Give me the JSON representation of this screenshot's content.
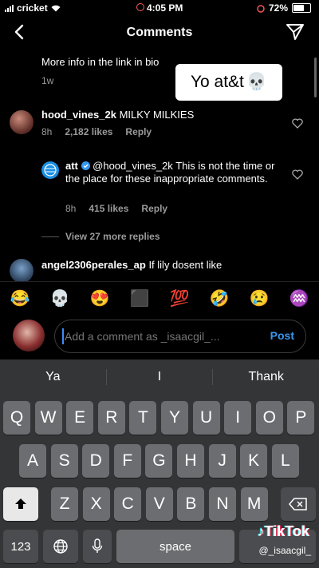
{
  "status": {
    "carrier": "cricket",
    "time": "4:05 PM",
    "battery": "72%",
    "battery_level": 0.72
  },
  "header": {
    "title": "Comments"
  },
  "caption": {
    "text": "More info in the link in bio",
    "time": "1w"
  },
  "overlay": {
    "text": "Yo at&t",
    "emoji": "💀"
  },
  "comments": [
    {
      "user": "hood_vines_2k",
      "text": "MILKY MILKIES",
      "time": "8h",
      "likes": "2,182 likes",
      "reply": "Reply"
    },
    {
      "user": "att",
      "mention": "@hood_vines_2k",
      "text": "This is not the time or the place for these inappropriate comments.",
      "time": "8h",
      "likes": "415 likes",
      "reply": "Reply",
      "verified": true
    },
    {
      "view_more": "View 27 more replies"
    },
    {
      "user": "angel2306perales_ap",
      "text": "If lily dosent like"
    }
  ],
  "emoji_bar": [
    "😂",
    "💀",
    "😍",
    "⬛",
    "💯",
    "🤣",
    "😢",
    "♒"
  ],
  "input": {
    "placeholder": "Add a comment as _isaacgil_...",
    "post_label": "Post"
  },
  "keyboard": {
    "suggestions": [
      "Ya",
      "I",
      "Thank"
    ],
    "row1": [
      "Q",
      "W",
      "E",
      "R",
      "T",
      "Y",
      "U",
      "I",
      "O",
      "P"
    ],
    "row2": [
      "A",
      "S",
      "D",
      "F",
      "G",
      "H",
      "J",
      "K",
      "L"
    ],
    "row3": [
      "Z",
      "X",
      "C",
      "V",
      "B",
      "N",
      "M"
    ],
    "num_label": "123",
    "space_label": "space"
  },
  "watermark": {
    "brand": "TikTok",
    "user": "@_isaacgil_"
  },
  "colors": {
    "accent": "#3897f0",
    "verified": "#3897f0"
  }
}
